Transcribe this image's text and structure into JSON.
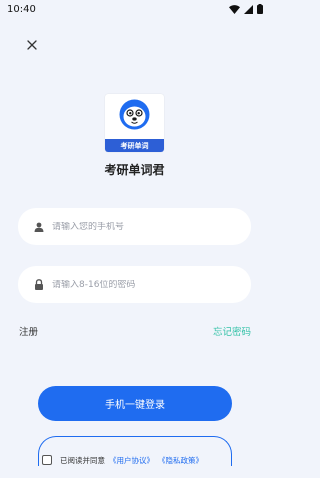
{
  "status_bar": {
    "time": "10:40"
  },
  "logo": {
    "banner_text": "考研单词"
  },
  "app_name": "考研单词君",
  "phone_field": {
    "placeholder": "请输入您的手机号"
  },
  "password_field": {
    "placeholder": "请输入8-16位的密码"
  },
  "links": {
    "register": "注册",
    "forgot": "忘记密码"
  },
  "login_button": {
    "label": "手机一键登录"
  },
  "agreement": {
    "prefix": "已阅读并同意",
    "user_agreement": "《用户协议》",
    "privacy_policy": "《隐私政策》"
  },
  "colors": {
    "primary": "#1f6cf0",
    "accent_link": "#35c2a8",
    "background": "#f1f4fb"
  }
}
